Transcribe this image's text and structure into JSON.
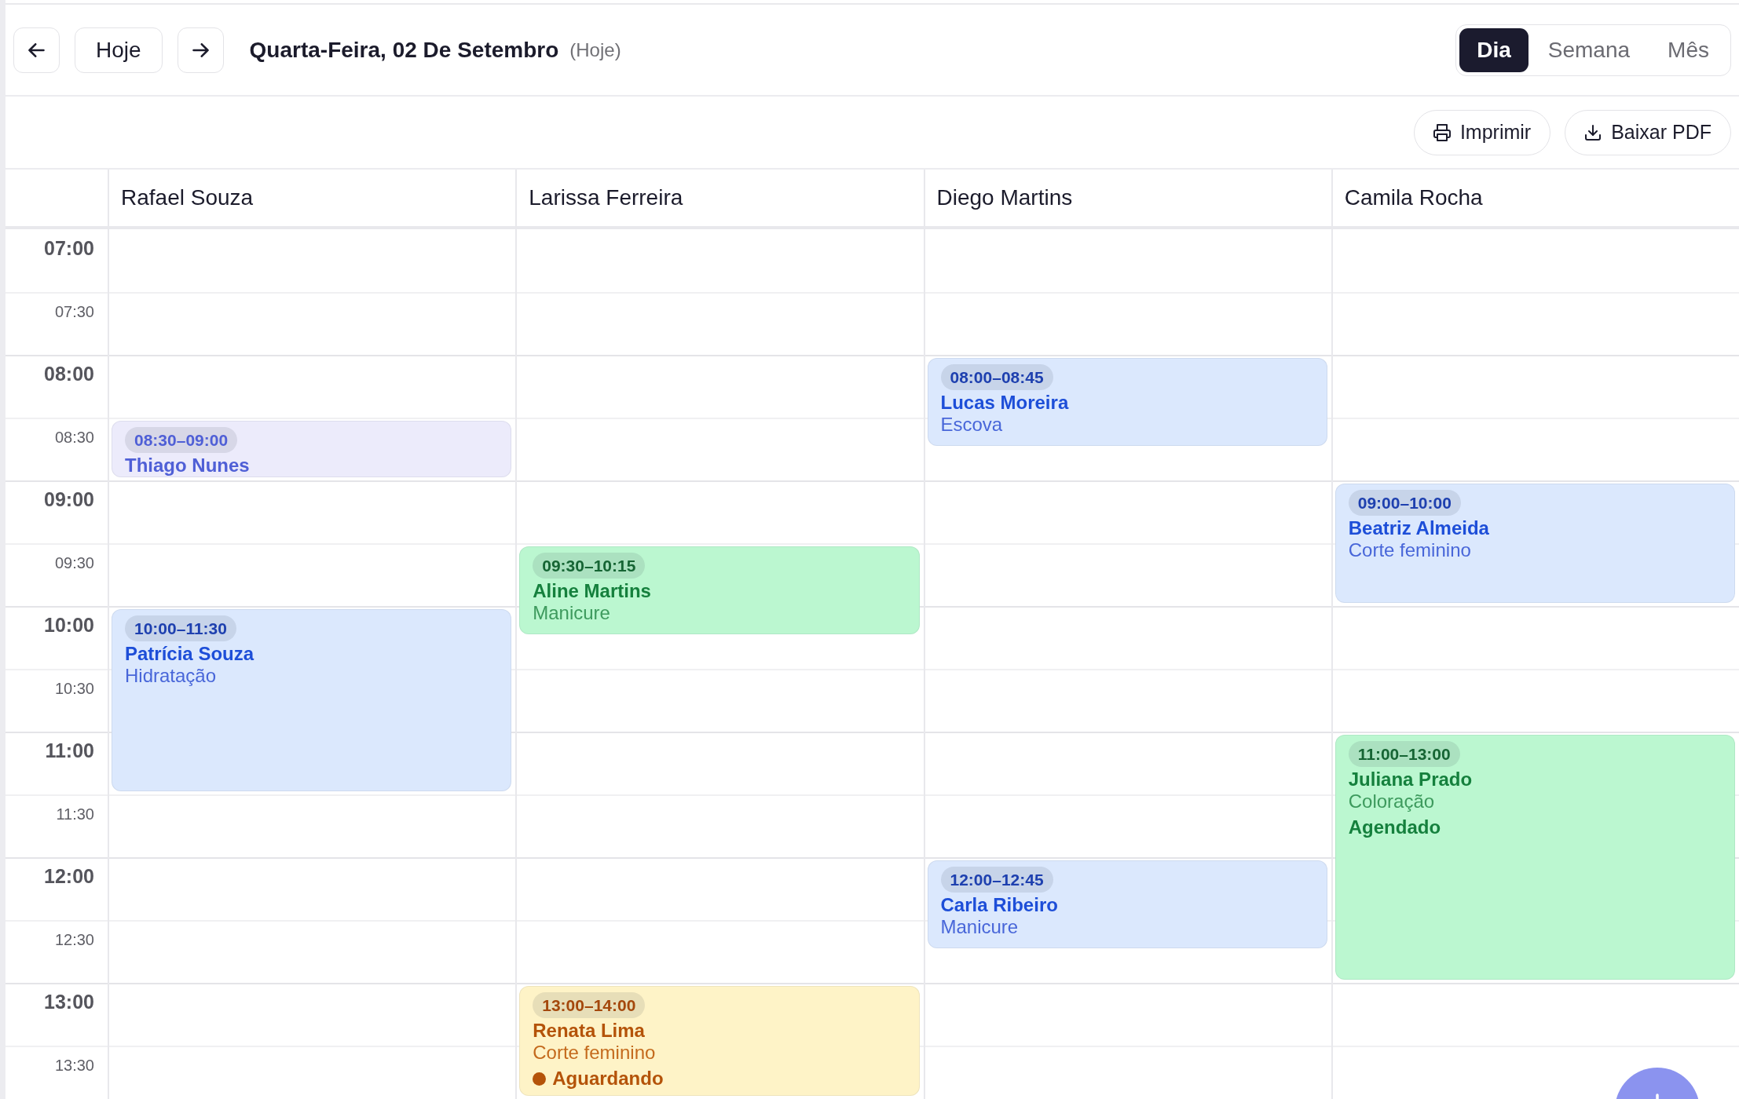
{
  "header": {
    "today_button": "Hoje",
    "date_title": "Quarta-Feira, 02 De Setembro",
    "date_note": "(Hoje)"
  },
  "view_tabs": [
    {
      "label": "Dia",
      "selected": true
    },
    {
      "label": "Semana",
      "selected": false
    },
    {
      "label": "Mês",
      "selected": false
    }
  ],
  "actions": [
    {
      "label": "Imprimir",
      "kind": "print"
    },
    {
      "label": "Baixar PDF",
      "kind": "download"
    }
  ],
  "time_slots": [
    {
      "label": "07:00",
      "kind": "hour"
    },
    {
      "label": "07:30",
      "kind": "half"
    },
    {
      "label": "08:00",
      "kind": "hour"
    },
    {
      "label": "08:30",
      "kind": "half"
    },
    {
      "label": "09:00",
      "kind": "hour"
    },
    {
      "label": "09:30",
      "kind": "half"
    },
    {
      "label": "10:00",
      "kind": "hour"
    },
    {
      "label": "10:30",
      "kind": "half"
    },
    {
      "label": "11:00",
      "kind": "hour"
    },
    {
      "label": "11:30",
      "kind": "half"
    },
    {
      "label": "12:00",
      "kind": "hour"
    },
    {
      "label": "12:30",
      "kind": "half"
    },
    {
      "label": "13:00",
      "kind": "hour"
    },
    {
      "label": "13:30",
      "kind": "half"
    }
  ],
  "staff": [
    {
      "name": "Rafael Souza",
      "appointments": [
        {
          "time": "08:30–09:00",
          "client": "Thiago Nunes",
          "color": "#ecebfb"
        },
        {
          "time": "10:00–11:30",
          "client": "Patrícia Souza",
          "service": "Hidratação",
          "color": "#dbe8fd"
        }
      ]
    },
    {
      "name": "Larissa Ferreira",
      "appointments": [
        {
          "time": "09:30–10:15",
          "client": "Aline Martins",
          "service": "Manicure",
          "color": "#bbf7d0"
        },
        {
          "time": "13:00–14:00",
          "client": "Renata Lima",
          "service": "Corte feminino",
          "color": "#fef3c7",
          "status": {
            "label": "Aguardando",
            "kind": "waiting"
          }
        }
      ]
    },
    {
      "name": "Diego Martins",
      "appointments": [
        {
          "time": "08:00–08:45",
          "client": "Lucas Moreira",
          "service": "Escova",
          "color": "#dbe8fd"
        },
        {
          "time": "12:00–12:45",
          "client": "Carla Ribeiro",
          "service": "Manicure",
          "color": "#dbe8fd"
        }
      ]
    },
    {
      "name": "Camila Rocha",
      "appointments": [
        {
          "time": "09:00–10:00",
          "client": "Beatriz Almeida",
          "service": "Corte feminino",
          "color": "#dbe8fd"
        },
        {
          "time": "11:00–13:00",
          "client": "Juliana Prado",
          "service": "Coloração",
          "color": "#bbf7d0",
          "status": {
            "label": "Agendado",
            "kind": "scheduled"
          }
        }
      ]
    }
  ]
}
